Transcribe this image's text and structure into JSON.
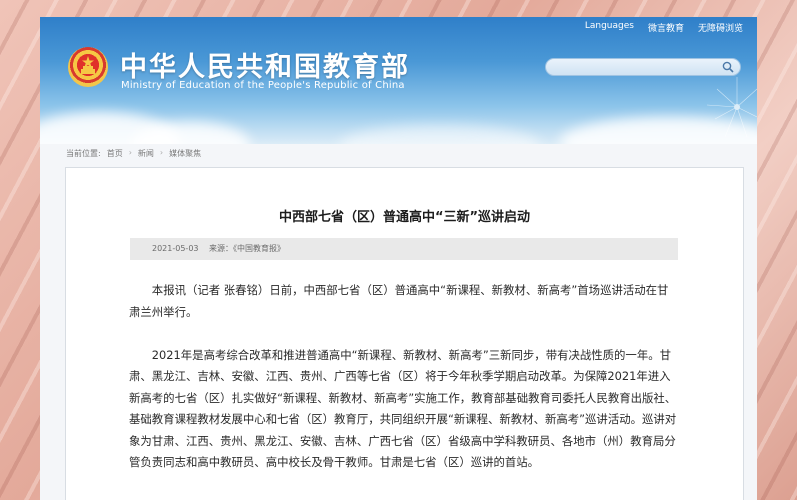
{
  "header": {
    "top_links": [
      "Languages",
      "微言教育",
      "无障碍浏览"
    ],
    "site_title": "中华人民共和国教育部",
    "site_subtitle": "Ministry of Education of the People's Republic of China",
    "search_placeholder": ""
  },
  "breadcrumb": {
    "prefix": "当前位置:",
    "items": [
      "首页",
      "新闻",
      "媒体聚焦"
    ],
    "separator": "›"
  },
  "article": {
    "title": "中西部七省（区）普通高中“三新”巡讲启动",
    "date": "2021-05-03",
    "source": "来源：《中国教育报》",
    "paragraphs": [
      "本报讯（记者 张春铭）日前，中西部七省（区）普通高中“新课程、新教材、新高考”首场巡讲活动在甘肃兰州举行。",
      "2021年是高考综合改革和推进普通高中“新课程、新教材、新高考”三新同步，带有决战性质的一年。甘肃、黑龙江、吉林、安徽、江西、贵州、广西等七省（区）将于今年秋季学期启动改革。为保障2021年进入新高考的七省（区）扎实做好“新课程、新教材、新高考”实施工作，教育部基础教育司委托人民教育出版社、基础教育课程教材发展中心和七省（区）教育厅，共同组织开展“新课程、新教材、新高考”巡讲活动。巡讲对象为甘肃、江西、贵州、黑龙江、安徽、吉林、广西七省（区）省级高中学科教研员、各地市（州）教育局分管负责同志和高中教研员、高中校长及骨干教师。甘肃是七省（区）巡讲的首站。"
    ]
  },
  "colors": {
    "header_top": "#2f7fc9",
    "frame_bg": "#e9b5a8",
    "emblem_red": "#e0302a",
    "emblem_gold": "#f6c744"
  }
}
